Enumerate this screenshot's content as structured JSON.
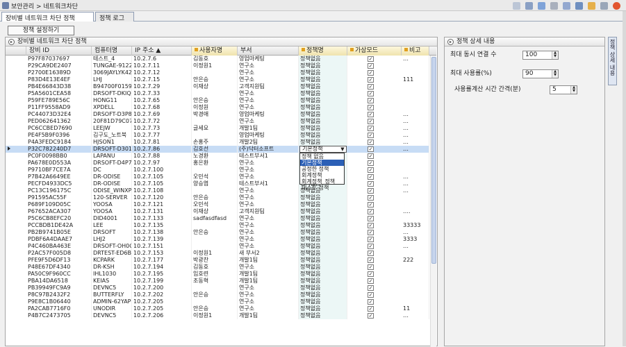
{
  "app": {
    "title": "보안관리 > 네트워크차단"
  },
  "tabs": [
    {
      "label": "장비별 네트워크 차단 정책"
    },
    {
      "label": "정책 로그"
    }
  ],
  "toolbar": {
    "set_policy_button": "정책 설정하기"
  },
  "left_panel": {
    "title": "장비별 네트워크 차단 정책"
  },
  "columns": [
    "장비 ID",
    "컴퓨터명",
    "IP 주소",
    "사용자명",
    "부서",
    "정책명",
    "가상모드",
    "비고"
  ],
  "rows": [
    [
      "P97F87037697",
      "테스트_4",
      "10.2.7.6",
      "김동호",
      "영업마케팅",
      "정책없음",
      "…"
    ],
    [
      "P29CA9DE2407",
      "TUNGAE-91223A9C",
      "10.2.7.11",
      "이정원1",
      "연구소",
      "정책없음",
      ""
    ],
    [
      "P2700E16389D",
      "3069JAYLYK4230X",
      "10.2.7.12",
      "",
      "연구소",
      "정책없음",
      ""
    ],
    [
      "P83D4E13E4EF",
      "LHJ",
      "10.2.7.15",
      "안은승",
      "연구소",
      "정책없음",
      "111"
    ],
    [
      "PB4E66843D38",
      "B94700F015934F2",
      "10.2.7.29",
      "이재상",
      "고객지원팀",
      "정책없음",
      ""
    ],
    [
      "P5A5601CEA58",
      "DRSOFT-DKIQ6KYZ",
      "10.2.7.33",
      "",
      "연구소",
      "정책없음",
      ""
    ],
    [
      "P59FE789E56C",
      "HONG11",
      "10.2.7.65",
      "안은승",
      "연구소",
      "정책없음",
      ""
    ],
    [
      "P11FF9558AD9",
      "XPDELL",
      "10.2.7.68",
      "이정원",
      "연구소",
      "정책없음",
      ""
    ],
    [
      "PC44073D32E4",
      "DRSOFT-D3P8K5BX",
      "10.2.7.69",
      "박경애",
      "영업마케팅",
      "정책없음",
      "…"
    ],
    [
      "PED062641362",
      "20F81D79C07F461",
      "10.2.7.72",
      "",
      "연구소",
      "정책없음",
      "…"
    ],
    [
      "PC6CCBED7690",
      "LEEJW",
      "10.2.7.73",
      "글세요",
      "개발1팀",
      "정책없음",
      "…"
    ],
    [
      "PE4F5B9F0396",
      "김구도_노트북",
      "10.2.7.77",
      "",
      "영업마케팅",
      "정책없음",
      "…"
    ],
    [
      "P4A3FEDC9184",
      "HJSON1",
      "10.2.7.81",
      "손홍주",
      "개발2팀",
      "정책없음",
      "…"
    ],
    [
      "P32C782240D7",
      "DRSOFT-D30115D5",
      "10.2.7.86",
      "김호선",
      "(주)닥터소프트",
      "기본정책",
      "…"
    ],
    [
      "PC0F0098BB0",
      "LAPANU",
      "10.2.7.88",
      "노경환",
      "테스트부서1",
      "정책없음",
      ""
    ],
    [
      "PA678E0D553A",
      "DRSOFT-D4P7K6BX",
      "10.2.7.97",
      "홍은환",
      "연구소",
      "정책없음",
      ""
    ],
    [
      "P9710BF7CE7A",
      "DC",
      "10.2.7.100",
      "",
      "연구소",
      "정책없음",
      ""
    ],
    [
      "P7B42A6649EE",
      "DR-ODISE",
      "10.2.7.105",
      "오민석",
      "연구소",
      "정책없음",
      "…"
    ],
    [
      "PECFD4933DC5",
      "DR-ODISE",
      "10.2.7.105",
      "양승엽",
      "테스트부서1",
      "정책없음",
      "…"
    ],
    [
      "PC13C196175C",
      "ODISE_WINXP",
      "10.2.7.108",
      "",
      "연구소",
      "정책없음",
      "…"
    ],
    [
      "P91595AC55F",
      "120-SERVER",
      "10.2.7.120",
      "안은승",
      "연구소",
      "정책없음",
      ""
    ],
    [
      "P689F109D05C",
      "YOOSA",
      "10.2.7.121",
      "오민석",
      "연구소",
      "정책없음",
      ""
    ],
    [
      "P67652ACA307",
      "YOOSA",
      "10.2.7.131",
      "이재상",
      "고객지원팀",
      "정책없음",
      "…."
    ],
    [
      "P5C6CB8EFC20",
      "DID4001",
      "10.2.7.133",
      "sadfasdfasd",
      "연구소",
      "정책없음",
      ""
    ],
    [
      "PCCBDB1DE42A",
      "LEE",
      "10.2.7.135",
      "",
      "연구소",
      "정책없음",
      "33333"
    ],
    [
      "PB2B9741B05E",
      "DRSOFT",
      "10.2.7.138",
      "안은승",
      "연구소",
      "정책없음",
      "…"
    ],
    [
      "PDBF6A4DAAE7",
      "LHJ2",
      "10.2.7.139",
      "",
      "연구소",
      "정책없음",
      "3333"
    ],
    [
      "P4C460BA463E",
      "DRSOFT-OH0OSH7N",
      "10.2.7.151",
      "",
      "연구소",
      "정책없음",
      "…"
    ],
    [
      "P2AC57F005D8",
      "DRTEST-ED6BB8C2",
      "10.2.7.153",
      "이정원1",
      "새 부서2",
      "정책없음",
      ""
    ],
    [
      "PFE9F5D6DF13",
      "KCPARK",
      "10.2.7.177",
      "박광찬",
      "개발1팀",
      "정책없음",
      "222"
    ],
    [
      "P48E67DF4340",
      "DR-KSH",
      "10.2.7.194",
      "김동호",
      "연구소",
      "정책없음",
      ""
    ],
    [
      "PA50C9F960CC",
      "IHL1030",
      "10.2.7.195",
      "임호련",
      "개발1팀",
      "정책없음",
      ""
    ],
    [
      "PBA14DA6518",
      "KEIAS",
      "10.2.7.199",
      "조동혁",
      "개발1팀",
      "정책없음",
      ""
    ],
    [
      "PB39949FC9A9",
      "DEVNC5",
      "10.2.7.200",
      "",
      "연구소",
      "정책없음",
      ""
    ],
    [
      "P8C97B2432F2",
      "BUTTERFLY",
      "10.2.7.202",
      "안은승",
      "연구소",
      "정책없음",
      ""
    ],
    [
      "P9E8C1B06440",
      "ADMIN-62YAP20GN",
      "10.2.7.205",
      "",
      "연구소",
      "정책없음",
      ""
    ],
    [
      "PA2CAB7716F0",
      "UNODIR",
      "10.2.7.205",
      "안은승",
      "연구소",
      "정책없음",
      "11"
    ],
    [
      "P4B7C2473705",
      "DEVNC5",
      "10.2.7.206",
      "이정원1",
      "개발1팀",
      "정책없음",
      "…"
    ]
  ],
  "dropdown": {
    "value": "기본정책",
    "options": [
      "정책 없음",
      "기본정책",
      "공정한 정책",
      "회계정책",
      "회계정책_정책",
      "테스트 정책"
    ]
  },
  "right_panel": {
    "title": "정책 상세 내용",
    "fields": [
      {
        "label": "최대 동시 연결 수",
        "value": "100"
      },
      {
        "label": "최대 사용률(%)",
        "value": "90"
      },
      {
        "label": "사용률계산 시간 간격(분)",
        "value": "5"
      }
    ],
    "side_tab": "정책 상세 내용"
  }
}
